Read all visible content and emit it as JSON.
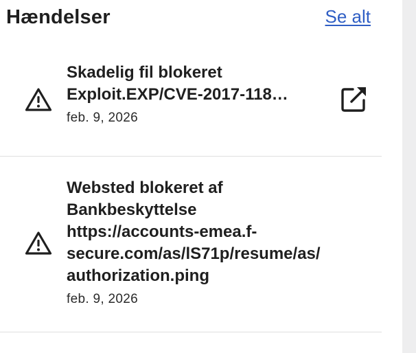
{
  "header": {
    "title": "Hændelser",
    "see_all_label": "Se alt"
  },
  "events": [
    {
      "lines": [
        "Skadelig fil blokeret",
        "Exploit.EXP/CVE-2017-118…"
      ],
      "date": "feb. 9, 2026",
      "icon": "warning-triangle-icon",
      "action_icon": "open-external-icon"
    },
    {
      "lines": [
        "Websted blokeret af",
        "Bankbeskyttelse",
        "https://accounts-emea.f-",
        "secure.com/as/lS71p/resume/as/",
        "authorization.ping"
      ],
      "date": "feb. 9, 2026",
      "icon": "warning-triangle-icon"
    }
  ],
  "colors": {
    "link": "#2f5ec4",
    "text": "#1f1f1f",
    "divider": "#dfdfdf",
    "scrollbar_track": "#eeeeef"
  }
}
